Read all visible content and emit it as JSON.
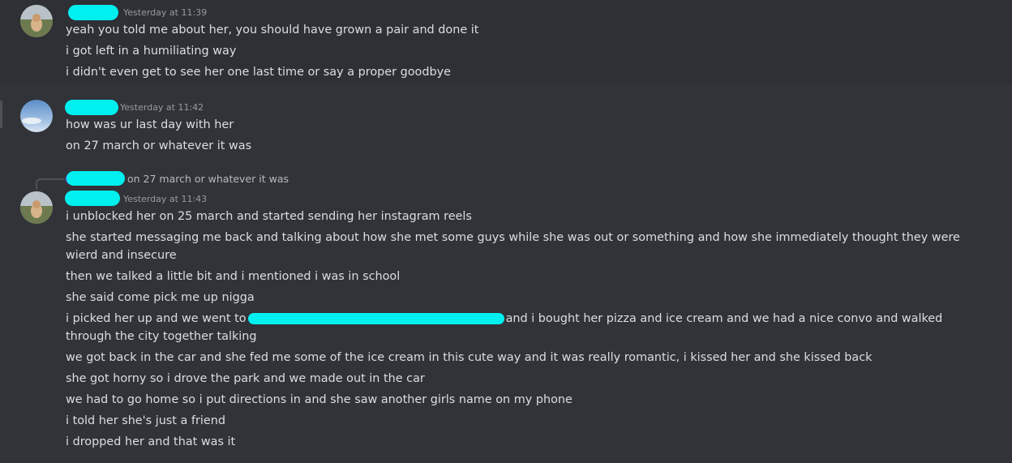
{
  "messages": [
    {
      "timestamp": "Yesterday at 11:39",
      "lines": [
        "yeah you told me about her, you should have grown a pair and done it",
        "i got left in a humiliating way",
        "i didn't even get to see her one last time or say a proper goodbye"
      ]
    },
    {
      "timestamp": "Yesterday at 11:42",
      "lines": [
        "how was ur last day with her",
        "on 27 march or whatever it was"
      ]
    },
    {
      "reply_preview": "on 27 march or whatever it was",
      "timestamp": "Yesterday at 11:43",
      "lines": [
        "i unblocked her on 25 march and started sending her instagram reels",
        "she started messaging me back and talking about how she met some guys while she was out or something and how she immediately thought they were wierd and insecure",
        "then we talked a little bit and i mentioned i was in school",
        "she said come pick me up nigga",
        "i picked her up and we went to",
        "and i bought her pizza and ice cream and we had a nice convo and walked through the city together talking",
        "we got back in the car and she fed me some of the ice cream in this cute way and it was really romantic, i kissed her and she kissed back",
        "she got horny so i drove the park and we made out in the car",
        "we had to go home so i put directions in and she saw another girls name on my phone",
        "i told her she's just a friend",
        "i dropped her and that was it"
      ]
    }
  ]
}
